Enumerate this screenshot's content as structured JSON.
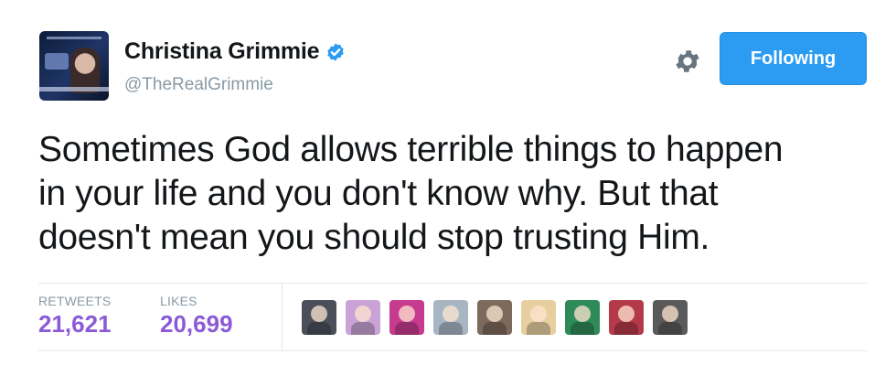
{
  "profile": {
    "name": "Christina Grimmie",
    "handle": "@TheRealGrimmie",
    "verified": true,
    "avatar_icon": "profile-photo"
  },
  "actions": {
    "settings_icon": "gear-icon",
    "follow_label": "Following",
    "accent_color": "#2b9cf2"
  },
  "tweet": {
    "lines": [
      "Sometimes God allows terrible things to happen",
      "in your life and you don't know why. But that",
      "doesn't mean you should stop trusting Him."
    ]
  },
  "stats": {
    "retweets_label": "RETWEETS",
    "retweets_value": "21,621",
    "likes_label": "LIKES",
    "likes_value": "20,699",
    "value_color": "#8b5bd6"
  },
  "likers": [
    {
      "icon": "liker-avatar-1",
      "color": "#4a4f5a"
    },
    {
      "icon": "liker-avatar-2",
      "color": "#c9a3d6"
    },
    {
      "icon": "liker-avatar-3",
      "color": "#c73b8f"
    },
    {
      "icon": "liker-avatar-4",
      "color": "#a8b6c4"
    },
    {
      "icon": "liker-avatar-5",
      "color": "#7d6a5c"
    },
    {
      "icon": "liker-avatar-6",
      "color": "#e8cfa0"
    },
    {
      "icon": "liker-avatar-7",
      "color": "#2f8a5a"
    },
    {
      "icon": "liker-avatar-8",
      "color": "#b43a4a"
    },
    {
      "icon": "liker-avatar-9",
      "color": "#5a5a5a"
    }
  ]
}
